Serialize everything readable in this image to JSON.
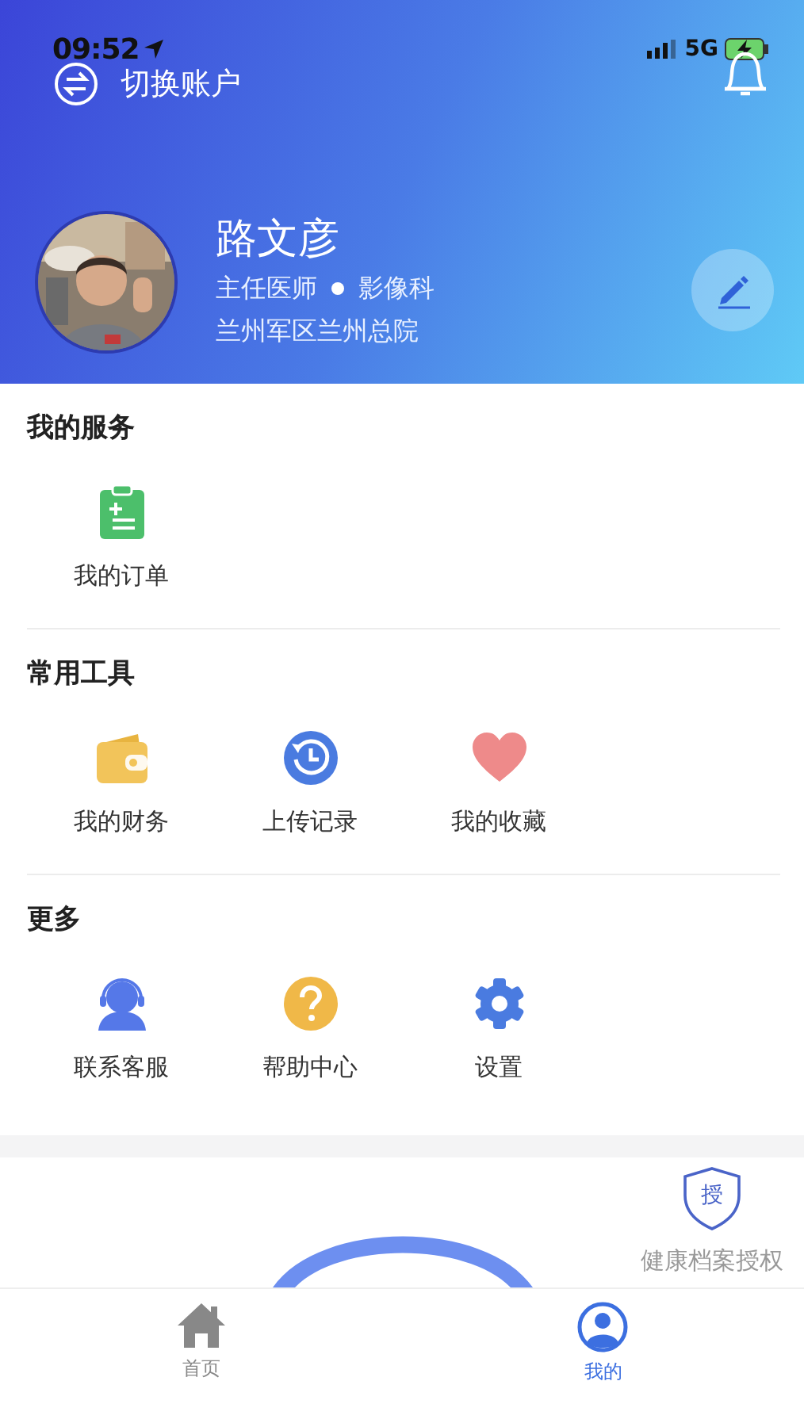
{
  "status_bar": {
    "time": "09:52",
    "network": "5G"
  },
  "header": {
    "switch_account": "切换账户",
    "name": "路文彦",
    "title": "主任医师",
    "department": "影像科",
    "hospital": "兰州军区兰州总院"
  },
  "sections": [
    {
      "title": "我的服务",
      "items": [
        {
          "label": "我的订单",
          "kind": "order"
        }
      ]
    },
    {
      "title": "常用工具",
      "items": [
        {
          "label": "我的财务",
          "kind": "wallet"
        },
        {
          "label": "上传记录",
          "kind": "history"
        },
        {
          "label": "我的收藏",
          "kind": "heart"
        }
      ]
    },
    {
      "title": "更多",
      "items": [
        {
          "label": "联系客服",
          "kind": "support"
        },
        {
          "label": "帮助中心",
          "kind": "help"
        },
        {
          "label": "设置",
          "kind": "settings"
        }
      ]
    }
  ],
  "authorization": {
    "badge": "授",
    "label": "健康档案授权"
  },
  "tabs": [
    {
      "label": "首页",
      "kind": "home",
      "selected": false
    },
    {
      "label": "我的",
      "kind": "profile",
      "selected": true
    }
  ]
}
